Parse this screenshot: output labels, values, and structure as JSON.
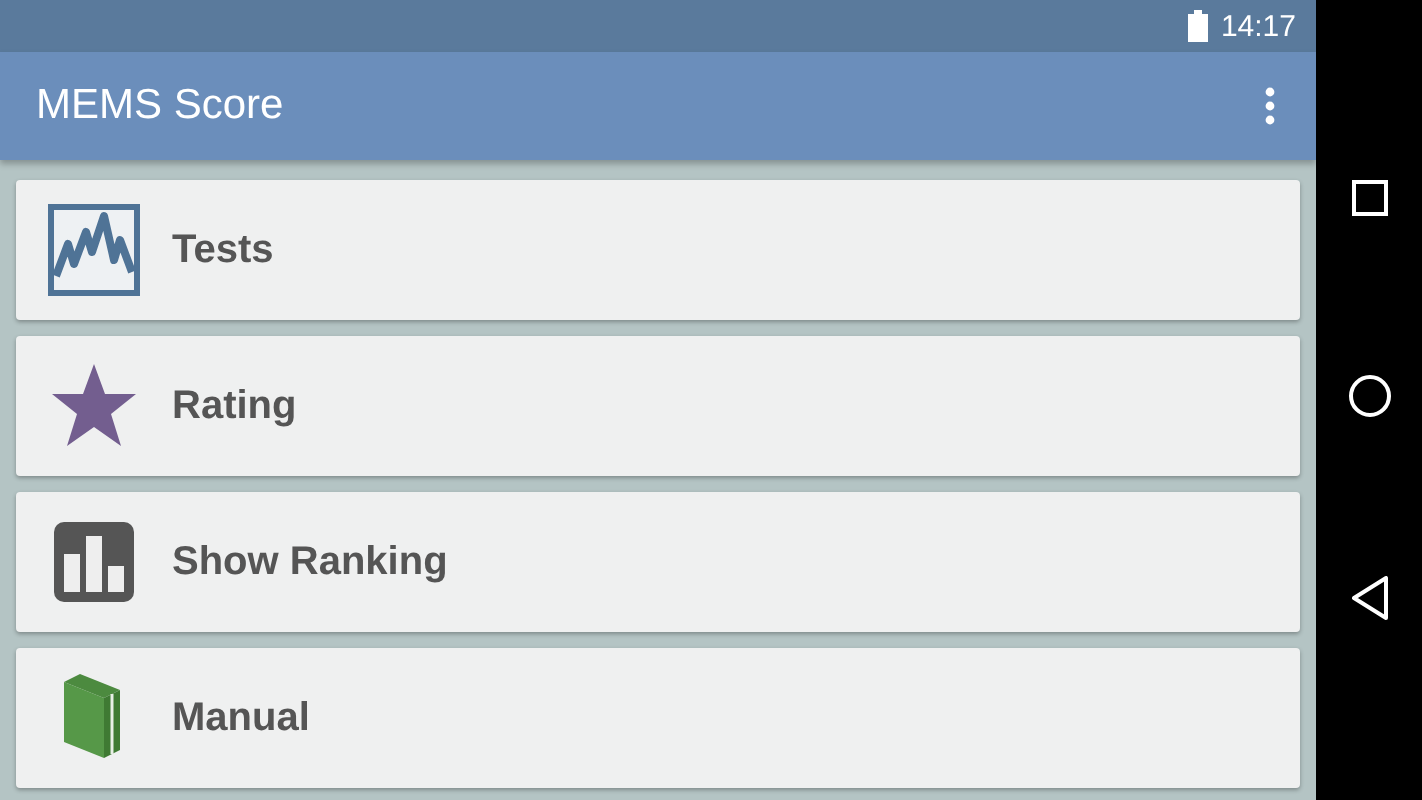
{
  "status_bar": {
    "time": "14:17"
  },
  "app_bar": {
    "title": "MEMS Score"
  },
  "menu": [
    {
      "kind": "tests",
      "label": "Tests"
    },
    {
      "kind": "rating",
      "label": "Rating"
    },
    {
      "kind": "ranking",
      "label": "Show Ranking"
    },
    {
      "kind": "manual",
      "label": "Manual"
    }
  ]
}
